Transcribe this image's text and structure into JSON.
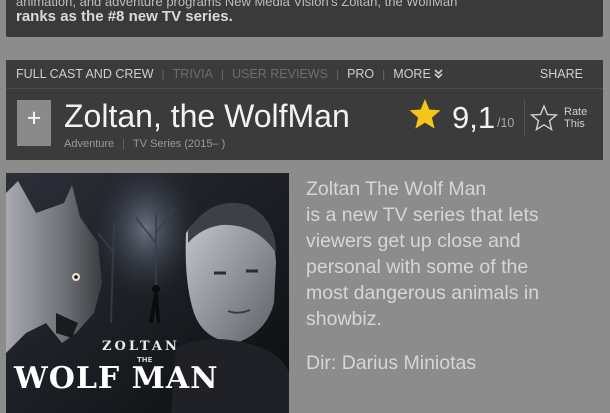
{
  "banner": {
    "line1": "animation, and adventure programs New Media Vision's Zoltan, the WolfMan",
    "line2": "ranks as the #8 new TV series."
  },
  "nav": {
    "items": [
      {
        "label": "FULL CAST AND CREW",
        "dim": false
      },
      {
        "label": "TRIVIA",
        "dim": true
      },
      {
        "label": "USER REVIEWS",
        "dim": true
      },
      {
        "label": "PRO",
        "dim": false
      },
      {
        "label": "MORE",
        "dim": false
      }
    ],
    "more_icon": "chevron-double-down-icon",
    "share": "SHARE"
  },
  "title": {
    "text": "Zoltan, the WolfMan",
    "genre": "Adventure",
    "type": "TV Series (2015– )",
    "watchlist_icon": "plus-icon"
  },
  "rating": {
    "score": "9,1",
    "out_of": "/10",
    "star_color": "#f5c518",
    "rate_label_1": "Rate",
    "rate_label_2": "This"
  },
  "poster": {
    "name": "ZOLTAN",
    "the": "THE",
    "title": "WOLF MAN"
  },
  "description": {
    "lines": [
      "Zoltan The Wolf Man",
      "is a new TV series that lets",
      "viewers get up close and",
      "personal with some of the",
      "most dangerous animals in",
      "showbiz."
    ],
    "director": "Dir: Darius Miniotas"
  }
}
